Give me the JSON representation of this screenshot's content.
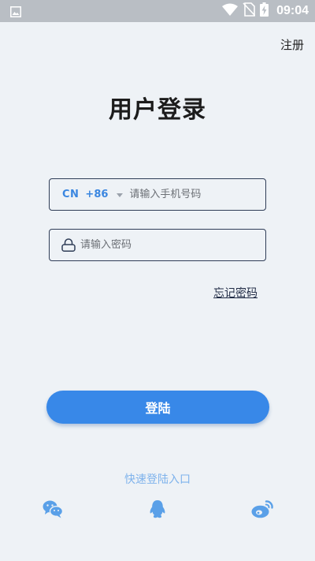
{
  "status_bar": {
    "time": "09:04",
    "icons": [
      "gallery-icon",
      "wifi-icon",
      "no-sim-icon",
      "battery-charging-icon"
    ]
  },
  "header": {
    "register_label": "注册"
  },
  "title": "用户登录",
  "phone_field": {
    "country": "CN",
    "dial_code": "+86",
    "placeholder": "请输入手机号码",
    "value": ""
  },
  "password_field": {
    "placeholder": "请输入密码",
    "value": "",
    "icon": "lock-icon"
  },
  "forgot_password_label": "忘记密码",
  "login_button_label": "登陆",
  "quick_login": {
    "label": "快速登陆入口",
    "providers": [
      "wechat-icon",
      "qq-icon",
      "weibo-icon"
    ]
  },
  "colors": {
    "accent": "#3888e8",
    "quick_link": "#7fb3ec",
    "social_icon": "#5aa0e8",
    "status_bar": "#b9bec4",
    "background": "#eef2f6"
  }
}
